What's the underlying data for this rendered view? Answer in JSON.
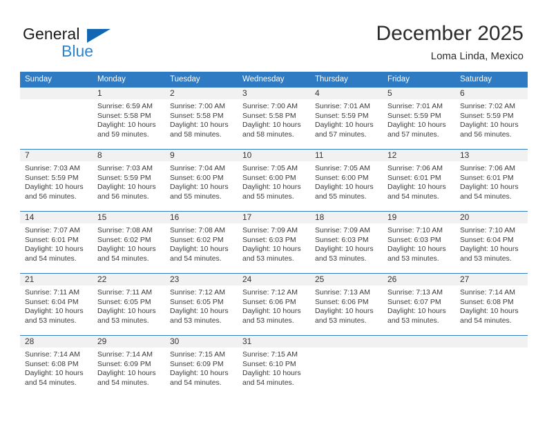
{
  "brand": {
    "word1": "General",
    "word2": "Blue",
    "triangle_color": "#1267b2",
    "blue_color": "#2a84d2"
  },
  "header": {
    "title": "December 2025",
    "subtitle": "Loma Linda, Mexico",
    "header_bg": "#2e7bc4",
    "header_text_color": "#ffffff",
    "daynum_band_bg": "#f1f1f1"
  },
  "weekdays": [
    "Sunday",
    "Monday",
    "Tuesday",
    "Wednesday",
    "Thursday",
    "Friday",
    "Saturday"
  ],
  "weeks": [
    [
      {
        "day": "",
        "sunrise": "",
        "sunset": "",
        "daylight1": "",
        "daylight2": ""
      },
      {
        "day": "1",
        "sunrise": "Sunrise: 6:59 AM",
        "sunset": "Sunset: 5:58 PM",
        "daylight1": "Daylight: 10 hours",
        "daylight2": "and 59 minutes."
      },
      {
        "day": "2",
        "sunrise": "Sunrise: 7:00 AM",
        "sunset": "Sunset: 5:58 PM",
        "daylight1": "Daylight: 10 hours",
        "daylight2": "and 58 minutes."
      },
      {
        "day": "3",
        "sunrise": "Sunrise: 7:00 AM",
        "sunset": "Sunset: 5:58 PM",
        "daylight1": "Daylight: 10 hours",
        "daylight2": "and 58 minutes."
      },
      {
        "day": "4",
        "sunrise": "Sunrise: 7:01 AM",
        "sunset": "Sunset: 5:59 PM",
        "daylight1": "Daylight: 10 hours",
        "daylight2": "and 57 minutes."
      },
      {
        "day": "5",
        "sunrise": "Sunrise: 7:01 AM",
        "sunset": "Sunset: 5:59 PM",
        "daylight1": "Daylight: 10 hours",
        "daylight2": "and 57 minutes."
      },
      {
        "day": "6",
        "sunrise": "Sunrise: 7:02 AM",
        "sunset": "Sunset: 5:59 PM",
        "daylight1": "Daylight: 10 hours",
        "daylight2": "and 56 minutes."
      }
    ],
    [
      {
        "day": "7",
        "sunrise": "Sunrise: 7:03 AM",
        "sunset": "Sunset: 5:59 PM",
        "daylight1": "Daylight: 10 hours",
        "daylight2": "and 56 minutes."
      },
      {
        "day": "8",
        "sunrise": "Sunrise: 7:03 AM",
        "sunset": "Sunset: 5:59 PM",
        "daylight1": "Daylight: 10 hours",
        "daylight2": "and 56 minutes."
      },
      {
        "day": "9",
        "sunrise": "Sunrise: 7:04 AM",
        "sunset": "Sunset: 6:00 PM",
        "daylight1": "Daylight: 10 hours",
        "daylight2": "and 55 minutes."
      },
      {
        "day": "10",
        "sunrise": "Sunrise: 7:05 AM",
        "sunset": "Sunset: 6:00 PM",
        "daylight1": "Daylight: 10 hours",
        "daylight2": "and 55 minutes."
      },
      {
        "day": "11",
        "sunrise": "Sunrise: 7:05 AM",
        "sunset": "Sunset: 6:00 PM",
        "daylight1": "Daylight: 10 hours",
        "daylight2": "and 55 minutes."
      },
      {
        "day": "12",
        "sunrise": "Sunrise: 7:06 AM",
        "sunset": "Sunset: 6:01 PM",
        "daylight1": "Daylight: 10 hours",
        "daylight2": "and 54 minutes."
      },
      {
        "day": "13",
        "sunrise": "Sunrise: 7:06 AM",
        "sunset": "Sunset: 6:01 PM",
        "daylight1": "Daylight: 10 hours",
        "daylight2": "and 54 minutes."
      }
    ],
    [
      {
        "day": "14",
        "sunrise": "Sunrise: 7:07 AM",
        "sunset": "Sunset: 6:01 PM",
        "daylight1": "Daylight: 10 hours",
        "daylight2": "and 54 minutes."
      },
      {
        "day": "15",
        "sunrise": "Sunrise: 7:08 AM",
        "sunset": "Sunset: 6:02 PM",
        "daylight1": "Daylight: 10 hours",
        "daylight2": "and 54 minutes."
      },
      {
        "day": "16",
        "sunrise": "Sunrise: 7:08 AM",
        "sunset": "Sunset: 6:02 PM",
        "daylight1": "Daylight: 10 hours",
        "daylight2": "and 54 minutes."
      },
      {
        "day": "17",
        "sunrise": "Sunrise: 7:09 AM",
        "sunset": "Sunset: 6:03 PM",
        "daylight1": "Daylight: 10 hours",
        "daylight2": "and 53 minutes."
      },
      {
        "day": "18",
        "sunrise": "Sunrise: 7:09 AM",
        "sunset": "Sunset: 6:03 PM",
        "daylight1": "Daylight: 10 hours",
        "daylight2": "and 53 minutes."
      },
      {
        "day": "19",
        "sunrise": "Sunrise: 7:10 AM",
        "sunset": "Sunset: 6:03 PM",
        "daylight1": "Daylight: 10 hours",
        "daylight2": "and 53 minutes."
      },
      {
        "day": "20",
        "sunrise": "Sunrise: 7:10 AM",
        "sunset": "Sunset: 6:04 PM",
        "daylight1": "Daylight: 10 hours",
        "daylight2": "and 53 minutes."
      }
    ],
    [
      {
        "day": "21",
        "sunrise": "Sunrise: 7:11 AM",
        "sunset": "Sunset: 6:04 PM",
        "daylight1": "Daylight: 10 hours",
        "daylight2": "and 53 minutes."
      },
      {
        "day": "22",
        "sunrise": "Sunrise: 7:11 AM",
        "sunset": "Sunset: 6:05 PM",
        "daylight1": "Daylight: 10 hours",
        "daylight2": "and 53 minutes."
      },
      {
        "day": "23",
        "sunrise": "Sunrise: 7:12 AM",
        "sunset": "Sunset: 6:05 PM",
        "daylight1": "Daylight: 10 hours",
        "daylight2": "and 53 minutes."
      },
      {
        "day": "24",
        "sunrise": "Sunrise: 7:12 AM",
        "sunset": "Sunset: 6:06 PM",
        "daylight1": "Daylight: 10 hours",
        "daylight2": "and 53 minutes."
      },
      {
        "day": "25",
        "sunrise": "Sunrise: 7:13 AM",
        "sunset": "Sunset: 6:06 PM",
        "daylight1": "Daylight: 10 hours",
        "daylight2": "and 53 minutes."
      },
      {
        "day": "26",
        "sunrise": "Sunrise: 7:13 AM",
        "sunset": "Sunset: 6:07 PM",
        "daylight1": "Daylight: 10 hours",
        "daylight2": "and 53 minutes."
      },
      {
        "day": "27",
        "sunrise": "Sunrise: 7:14 AM",
        "sunset": "Sunset: 6:08 PM",
        "daylight1": "Daylight: 10 hours",
        "daylight2": "and 54 minutes."
      }
    ],
    [
      {
        "day": "28",
        "sunrise": "Sunrise: 7:14 AM",
        "sunset": "Sunset: 6:08 PM",
        "daylight1": "Daylight: 10 hours",
        "daylight2": "and 54 minutes."
      },
      {
        "day": "29",
        "sunrise": "Sunrise: 7:14 AM",
        "sunset": "Sunset: 6:09 PM",
        "daylight1": "Daylight: 10 hours",
        "daylight2": "and 54 minutes."
      },
      {
        "day": "30",
        "sunrise": "Sunrise: 7:15 AM",
        "sunset": "Sunset: 6:09 PM",
        "daylight1": "Daylight: 10 hours",
        "daylight2": "and 54 minutes."
      },
      {
        "day": "31",
        "sunrise": "Sunrise: 7:15 AM",
        "sunset": "Sunset: 6:10 PM",
        "daylight1": "Daylight: 10 hours",
        "daylight2": "and 54 minutes."
      },
      {
        "day": "",
        "sunrise": "",
        "sunset": "",
        "daylight1": "",
        "daylight2": ""
      },
      {
        "day": "",
        "sunrise": "",
        "sunset": "",
        "daylight1": "",
        "daylight2": ""
      },
      {
        "day": "",
        "sunrise": "",
        "sunset": "",
        "daylight1": "",
        "daylight2": ""
      }
    ]
  ]
}
